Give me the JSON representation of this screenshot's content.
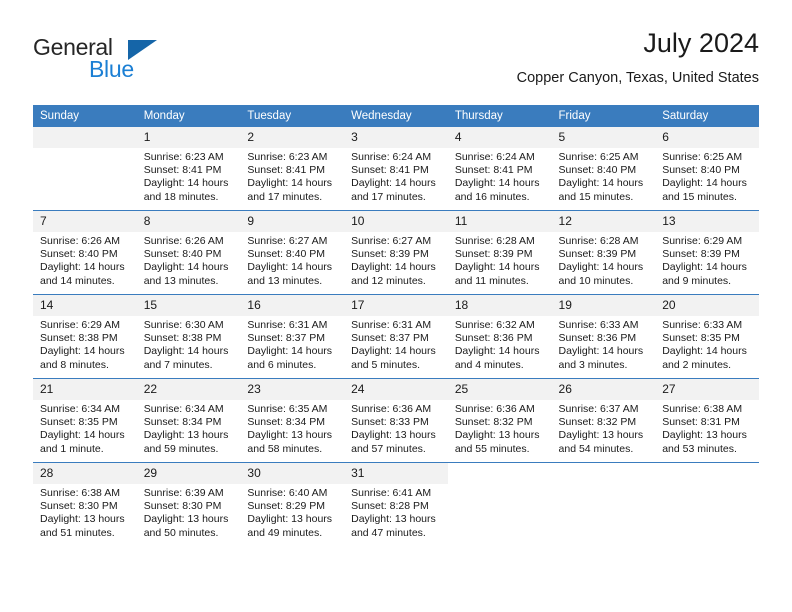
{
  "brand": {
    "name_part1": "General",
    "name_part2": "Blue",
    "accent_color": "#1b7fd4",
    "triangle_color": "#1565a8"
  },
  "header": {
    "title": "July 2024",
    "subtitle": "Copper Canyon, Texas, United States"
  },
  "calendar": {
    "header_bg": "#3a7cbe",
    "daynum_bg": "#f2f2f2",
    "weekday_headers": [
      "Sunday",
      "Monday",
      "Tuesday",
      "Wednesday",
      "Thursday",
      "Friday",
      "Saturday"
    ],
    "labels": {
      "sunrise": "Sunrise:",
      "sunset": "Sunset:",
      "daylight": "Daylight:"
    },
    "weeks": [
      [
        {
          "day": "",
          "sunrise": "",
          "sunset": "",
          "daylight_line1": "",
          "daylight_line2": ""
        },
        {
          "day": "1",
          "sunrise": "Sunrise: 6:23 AM",
          "sunset": "Sunset: 8:41 PM",
          "daylight_line1": "Daylight: 14 hours",
          "daylight_line2": "and 18 minutes."
        },
        {
          "day": "2",
          "sunrise": "Sunrise: 6:23 AM",
          "sunset": "Sunset: 8:41 PM",
          "daylight_line1": "Daylight: 14 hours",
          "daylight_line2": "and 17 minutes."
        },
        {
          "day": "3",
          "sunrise": "Sunrise: 6:24 AM",
          "sunset": "Sunset: 8:41 PM",
          "daylight_line1": "Daylight: 14 hours",
          "daylight_line2": "and 17 minutes."
        },
        {
          "day": "4",
          "sunrise": "Sunrise: 6:24 AM",
          "sunset": "Sunset: 8:41 PM",
          "daylight_line1": "Daylight: 14 hours",
          "daylight_line2": "and 16 minutes."
        },
        {
          "day": "5",
          "sunrise": "Sunrise: 6:25 AM",
          "sunset": "Sunset: 8:40 PM",
          "daylight_line1": "Daylight: 14 hours",
          "daylight_line2": "and 15 minutes."
        },
        {
          "day": "6",
          "sunrise": "Sunrise: 6:25 AM",
          "sunset": "Sunset: 8:40 PM",
          "daylight_line1": "Daylight: 14 hours",
          "daylight_line2": "and 15 minutes."
        }
      ],
      [
        {
          "day": "7",
          "sunrise": "Sunrise: 6:26 AM",
          "sunset": "Sunset: 8:40 PM",
          "daylight_line1": "Daylight: 14 hours",
          "daylight_line2": "and 14 minutes."
        },
        {
          "day": "8",
          "sunrise": "Sunrise: 6:26 AM",
          "sunset": "Sunset: 8:40 PM",
          "daylight_line1": "Daylight: 14 hours",
          "daylight_line2": "and 13 minutes."
        },
        {
          "day": "9",
          "sunrise": "Sunrise: 6:27 AM",
          "sunset": "Sunset: 8:40 PM",
          "daylight_line1": "Daylight: 14 hours",
          "daylight_line2": "and 13 minutes."
        },
        {
          "day": "10",
          "sunrise": "Sunrise: 6:27 AM",
          "sunset": "Sunset: 8:39 PM",
          "daylight_line1": "Daylight: 14 hours",
          "daylight_line2": "and 12 minutes."
        },
        {
          "day": "11",
          "sunrise": "Sunrise: 6:28 AM",
          "sunset": "Sunset: 8:39 PM",
          "daylight_line1": "Daylight: 14 hours",
          "daylight_line2": "and 11 minutes."
        },
        {
          "day": "12",
          "sunrise": "Sunrise: 6:28 AM",
          "sunset": "Sunset: 8:39 PM",
          "daylight_line1": "Daylight: 14 hours",
          "daylight_line2": "and 10 minutes."
        },
        {
          "day": "13",
          "sunrise": "Sunrise: 6:29 AM",
          "sunset": "Sunset: 8:39 PM",
          "daylight_line1": "Daylight: 14 hours",
          "daylight_line2": "and 9 minutes."
        }
      ],
      [
        {
          "day": "14",
          "sunrise": "Sunrise: 6:29 AM",
          "sunset": "Sunset: 8:38 PM",
          "daylight_line1": "Daylight: 14 hours",
          "daylight_line2": "and 8 minutes."
        },
        {
          "day": "15",
          "sunrise": "Sunrise: 6:30 AM",
          "sunset": "Sunset: 8:38 PM",
          "daylight_line1": "Daylight: 14 hours",
          "daylight_line2": "and 7 minutes."
        },
        {
          "day": "16",
          "sunrise": "Sunrise: 6:31 AM",
          "sunset": "Sunset: 8:37 PM",
          "daylight_line1": "Daylight: 14 hours",
          "daylight_line2": "and 6 minutes."
        },
        {
          "day": "17",
          "sunrise": "Sunrise: 6:31 AM",
          "sunset": "Sunset: 8:37 PM",
          "daylight_line1": "Daylight: 14 hours",
          "daylight_line2": "and 5 minutes."
        },
        {
          "day": "18",
          "sunrise": "Sunrise: 6:32 AM",
          "sunset": "Sunset: 8:36 PM",
          "daylight_line1": "Daylight: 14 hours",
          "daylight_line2": "and 4 minutes."
        },
        {
          "day": "19",
          "sunrise": "Sunrise: 6:33 AM",
          "sunset": "Sunset: 8:36 PM",
          "daylight_line1": "Daylight: 14 hours",
          "daylight_line2": "and 3 minutes."
        },
        {
          "day": "20",
          "sunrise": "Sunrise: 6:33 AM",
          "sunset": "Sunset: 8:35 PM",
          "daylight_line1": "Daylight: 14 hours",
          "daylight_line2": "and 2 minutes."
        }
      ],
      [
        {
          "day": "21",
          "sunrise": "Sunrise: 6:34 AM",
          "sunset": "Sunset: 8:35 PM",
          "daylight_line1": "Daylight: 14 hours",
          "daylight_line2": "and 1 minute."
        },
        {
          "day": "22",
          "sunrise": "Sunrise: 6:34 AM",
          "sunset": "Sunset: 8:34 PM",
          "daylight_line1": "Daylight: 13 hours",
          "daylight_line2": "and 59 minutes."
        },
        {
          "day": "23",
          "sunrise": "Sunrise: 6:35 AM",
          "sunset": "Sunset: 8:34 PM",
          "daylight_line1": "Daylight: 13 hours",
          "daylight_line2": "and 58 minutes."
        },
        {
          "day": "24",
          "sunrise": "Sunrise: 6:36 AM",
          "sunset": "Sunset: 8:33 PM",
          "daylight_line1": "Daylight: 13 hours",
          "daylight_line2": "and 57 minutes."
        },
        {
          "day": "25",
          "sunrise": "Sunrise: 6:36 AM",
          "sunset": "Sunset: 8:32 PM",
          "daylight_line1": "Daylight: 13 hours",
          "daylight_line2": "and 55 minutes."
        },
        {
          "day": "26",
          "sunrise": "Sunrise: 6:37 AM",
          "sunset": "Sunset: 8:32 PM",
          "daylight_line1": "Daylight: 13 hours",
          "daylight_line2": "and 54 minutes."
        },
        {
          "day": "27",
          "sunrise": "Sunrise: 6:38 AM",
          "sunset": "Sunset: 8:31 PM",
          "daylight_line1": "Daylight: 13 hours",
          "daylight_line2": "and 53 minutes."
        }
      ],
      [
        {
          "day": "28",
          "sunrise": "Sunrise: 6:38 AM",
          "sunset": "Sunset: 8:30 PM",
          "daylight_line1": "Daylight: 13 hours",
          "daylight_line2": "and 51 minutes."
        },
        {
          "day": "29",
          "sunrise": "Sunrise: 6:39 AM",
          "sunset": "Sunset: 8:30 PM",
          "daylight_line1": "Daylight: 13 hours",
          "daylight_line2": "and 50 minutes."
        },
        {
          "day": "30",
          "sunrise": "Sunrise: 6:40 AM",
          "sunset": "Sunset: 8:29 PM",
          "daylight_line1": "Daylight: 13 hours",
          "daylight_line2": "and 49 minutes."
        },
        {
          "day": "31",
          "sunrise": "Sunrise: 6:41 AM",
          "sunset": "Sunset: 8:28 PM",
          "daylight_line1": "Daylight: 13 hours",
          "daylight_line2": "and 47 minutes."
        },
        {
          "day": "",
          "sunrise": "",
          "sunset": "",
          "daylight_line1": "",
          "daylight_line2": ""
        },
        {
          "day": "",
          "sunrise": "",
          "sunset": "",
          "daylight_line1": "",
          "daylight_line2": ""
        },
        {
          "day": "",
          "sunrise": "",
          "sunset": "",
          "daylight_line1": "",
          "daylight_line2": ""
        }
      ]
    ]
  }
}
